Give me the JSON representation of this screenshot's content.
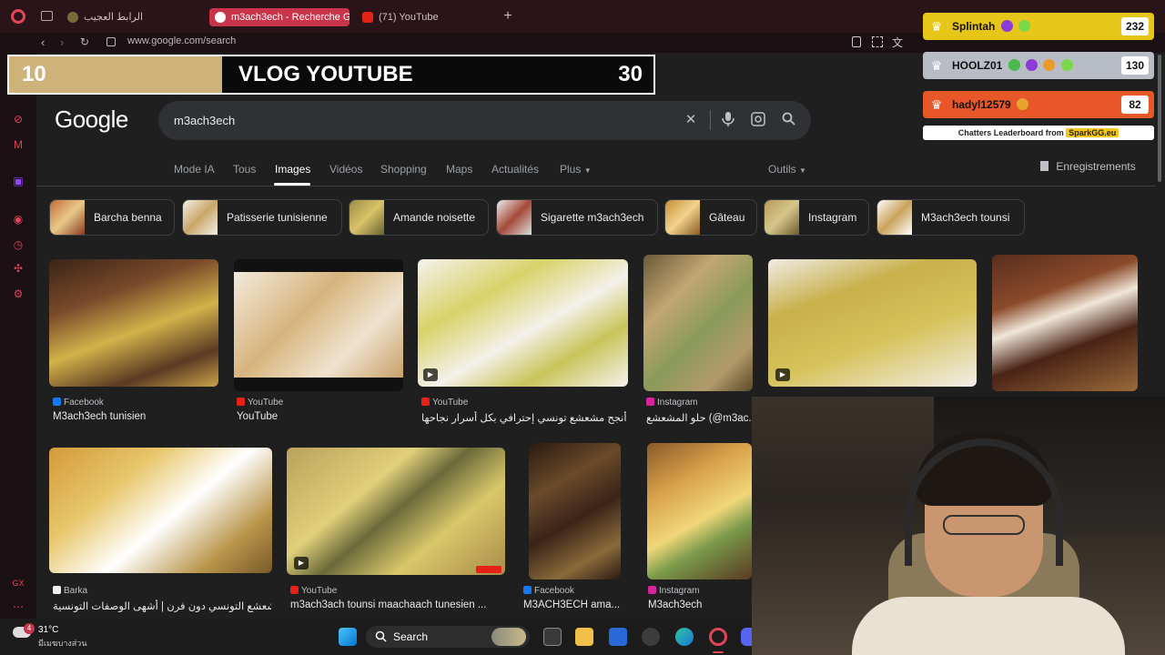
{
  "browser": {
    "tabs": [
      {
        "label": "الرابط العجيب",
        "active": false
      },
      {
        "label": "m3ach3ech - Recherche G",
        "active": true
      },
      {
        "label": "(71) YouTube",
        "active": false
      }
    ],
    "new_tab_symbol": "+",
    "url": "www.google.com/search"
  },
  "overlay_banner": {
    "left_value": "10",
    "title": "VLOG YOUTUBE",
    "right_value": "30",
    "progress_fraction": 0.33
  },
  "google": {
    "logo": "Google",
    "query": "m3ach3ech",
    "nav_tabs": [
      "Mode IA",
      "Tous",
      "Images",
      "Vidéos",
      "Shopping",
      "Maps",
      "Actualités",
      "Plus"
    ],
    "active_tab": "Images",
    "tools_label": "Outils",
    "saved_label": "Enregistrements",
    "chips": [
      "Barcha benna",
      "Patisserie tunisienne",
      "Amande noisette",
      "Sigarette m3ach3ech",
      "Gâteau",
      "Instagram",
      "M3ach3ech tounsi"
    ],
    "results_row1": [
      {
        "source": "Facebook",
        "title": "M3ach3ech tunisien"
      },
      {
        "source": "YouTube",
        "title": "YouTube"
      },
      {
        "source": "YouTube",
        "title": "اسهل و أنجح مشعشع تونسي إحترافي بكل أسرار نجاحها ..."
      },
      {
        "source": "Instagram",
        "title": "حلو المشعشع (@m3ac..."
      },
      {
        "source": "",
        "title": ""
      },
      {
        "source": "",
        "title": ""
      }
    ],
    "results_row2": [
      {
        "source": "Barka",
        "title": "حلويات المشعشع التونسي دون فرن | أشهى الوصفات التونسية"
      },
      {
        "source": "YouTube",
        "title": "m3ach3ach tounsi maachaach tunesien ..."
      },
      {
        "source": "Facebook",
        "title": "M3ACH3ECH ama..."
      },
      {
        "source": "Instagram",
        "title": "M3ach3ech"
      }
    ]
  },
  "leaderboard": {
    "rows": [
      {
        "name": "Splintah",
        "score": "232"
      },
      {
        "name": "HOOLZ01",
        "score": "130"
      },
      {
        "name": "hadyl12579",
        "score": "82"
      }
    ],
    "footer_text": "Chatters Leaderboard from",
    "footer_brand": "SparkGG.eu"
  },
  "taskbar": {
    "weather_temp": "31°C",
    "weather_desc": "มีเมฆบางส่วน",
    "weather_badge": "4",
    "search_label": "Search"
  },
  "colors": {
    "accent_red": "#c8354a",
    "banner_gold": "#cdb27a",
    "lb_gold": "#e6c619",
    "lb_silver": "#b8bcc4",
    "lb_bronze": "#e8572a"
  }
}
